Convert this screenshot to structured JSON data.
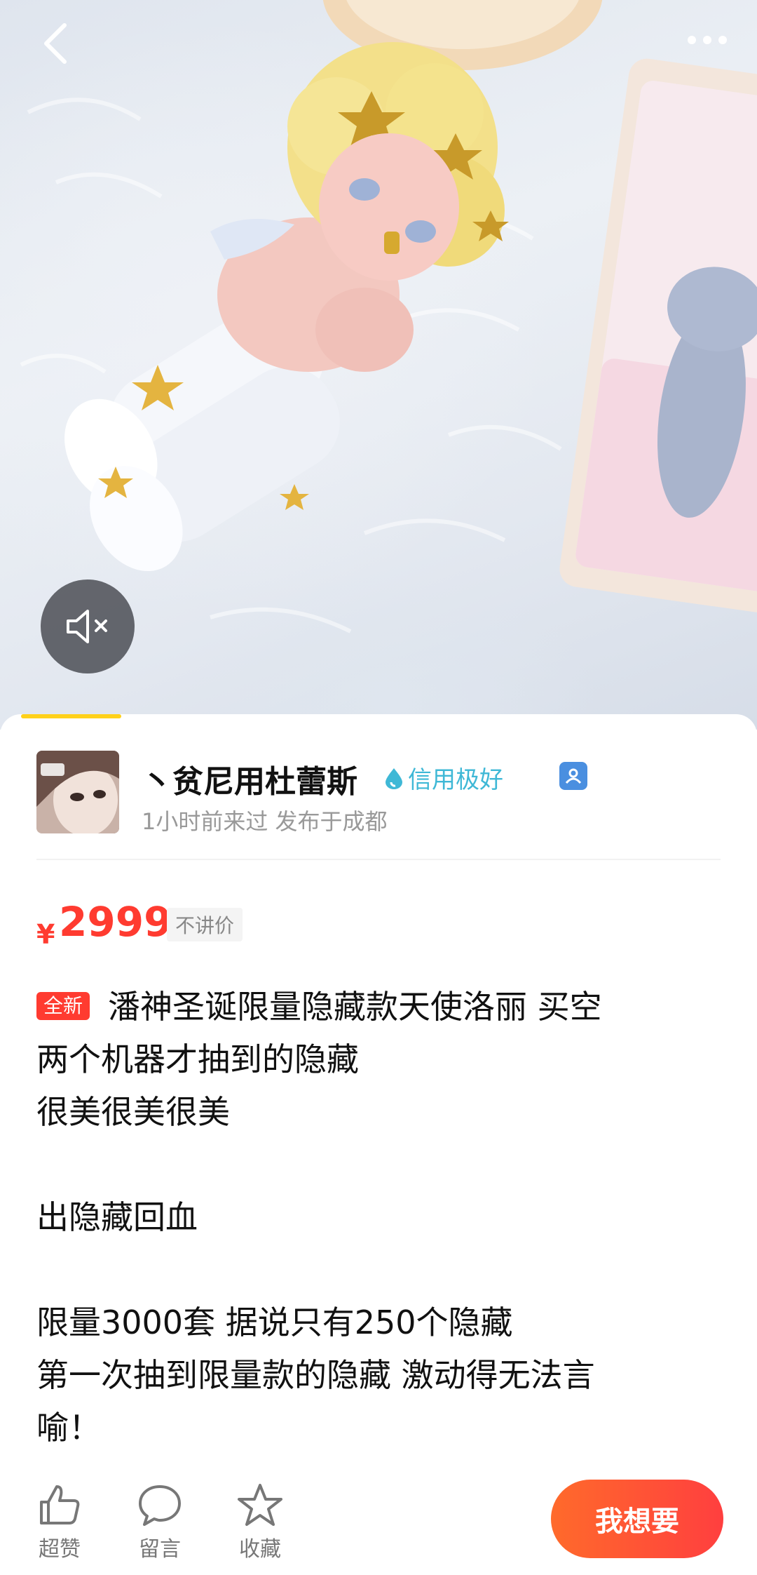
{
  "media": {
    "progress_fraction": 0.14
  },
  "seller": {
    "name": "丶贫尼用杜蕾斯",
    "credit": "信用极好",
    "meta": "1小时前来过 发布于成都"
  },
  "price": {
    "symbol": "¥",
    "value": "2999",
    "tag": "不讲价"
  },
  "description": {
    "badge": "全新",
    "lines": [
      "潘神圣诞限量隐藏款天使洛丽 买空",
      "两个机器才抽到的隐藏",
      "很美很美很美",
      "",
      "出隐藏回血",
      "",
      "限量3000套 据说只有250个隐藏",
      "第一次抽到限量款的隐藏 激动得无法言",
      "喻！"
    ]
  },
  "actions": {
    "like": "超赞",
    "comment": "留言",
    "favorite": "收藏",
    "want": "我想要"
  },
  "colors": {
    "price": "#ff3b30",
    "credit": "#3fb8d6",
    "progress": "#ffd11a",
    "want_button": "#ff5533"
  }
}
